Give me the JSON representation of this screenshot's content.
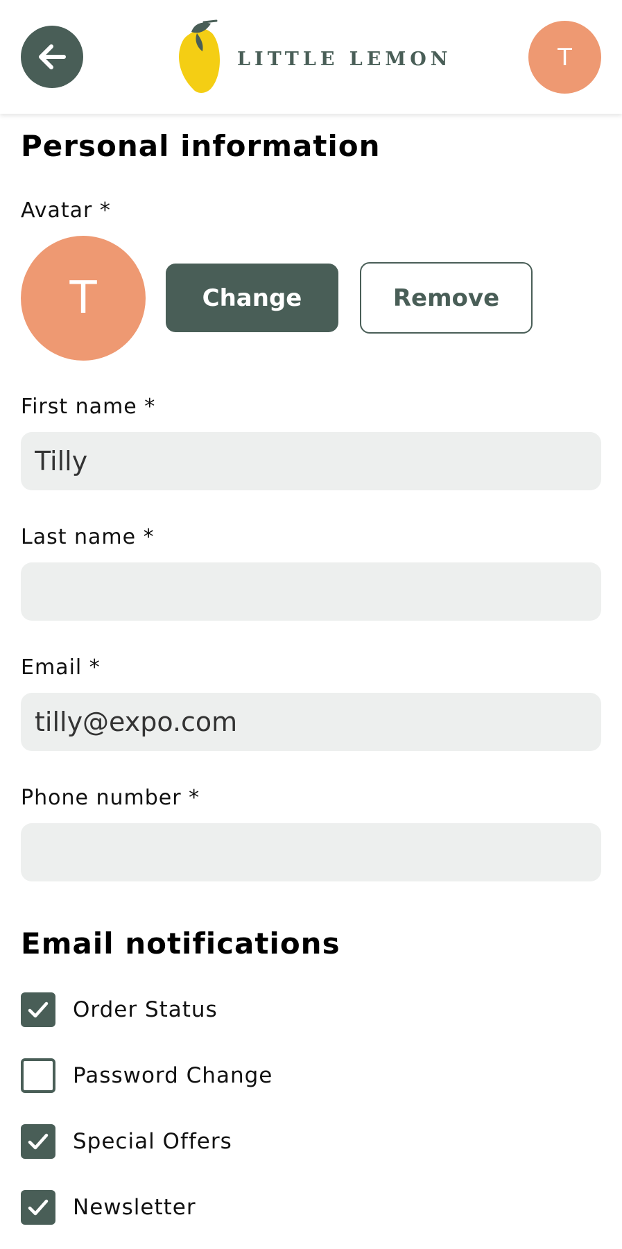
{
  "header": {
    "back_icon": "arrow-left-icon",
    "logo_text": "LITTLE LEMON",
    "avatar_initial": "T"
  },
  "personal": {
    "title": "Personal information",
    "avatar_label": "Avatar *",
    "avatar_initial": "T",
    "change_label": "Change",
    "remove_label": "Remove",
    "first_name_label": "First name *",
    "first_name_value": "Tilly",
    "last_name_label": "Last name *",
    "last_name_value": "",
    "email_label": "Email *",
    "email_value": "tilly@expo.com",
    "phone_label": "Phone number *",
    "phone_value": ""
  },
  "notifications": {
    "title": "Email notifications",
    "items": [
      {
        "label": "Order Status",
        "checked": true
      },
      {
        "label": "Password Change",
        "checked": false
      },
      {
        "label": "Special Offers",
        "checked": true
      },
      {
        "label": "Newsletter",
        "checked": true
      }
    ]
  },
  "colors": {
    "primary": "#495e57",
    "avatar": "#ee9972",
    "input_bg": "#edefee",
    "lemon": "#f4ce14"
  }
}
